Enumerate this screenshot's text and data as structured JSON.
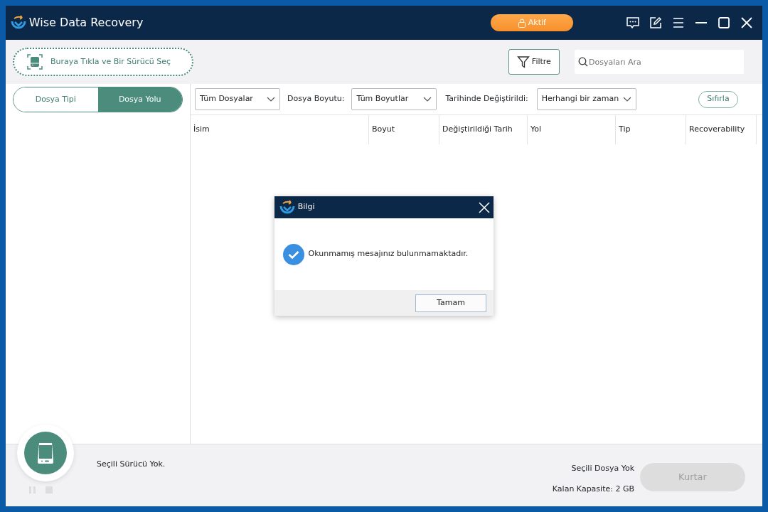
{
  "window": {
    "title": "Wise Data Recovery"
  },
  "activate_button": {
    "label": "Aktif"
  },
  "drive_selector": {
    "label": "Buraya Tıkla ve Bir Sürücü Seç"
  },
  "filter_button": {
    "label": "Filtre"
  },
  "search": {
    "placeholder": "Dosyaları Ara"
  },
  "view_tabs": [
    {
      "label": "Dosya Tipi",
      "selected": false
    },
    {
      "label": "Dosya Yolu",
      "selected": true
    }
  ],
  "filters": {
    "file_type": "Tüm Dosyalar",
    "size_label": "Dosya Boyutu:",
    "size": "Tüm Boyutlar",
    "date_label": "Tarihinde Değiştirildi:",
    "date": "Herhangi bir zaman",
    "reset": "Sıfırla"
  },
  "table": {
    "columns": [
      "İsim",
      "Boyut",
      "Değiştirildiği Tarih",
      "Yol",
      "Tip",
      "Recoverability"
    ]
  },
  "status": {
    "drive": "Seçili Sürücü Yok.",
    "files": "Seçili Dosya Yok",
    "capacity": "Kalan Kapasite: 2 GB",
    "recover_button": {
      "label": "Kurtar",
      "disabled": true
    }
  },
  "dialog": {
    "title": "Bilgi",
    "message": "Okunmamış mesajınız bulunmamaktadır.",
    "ok": "Tamam"
  }
}
